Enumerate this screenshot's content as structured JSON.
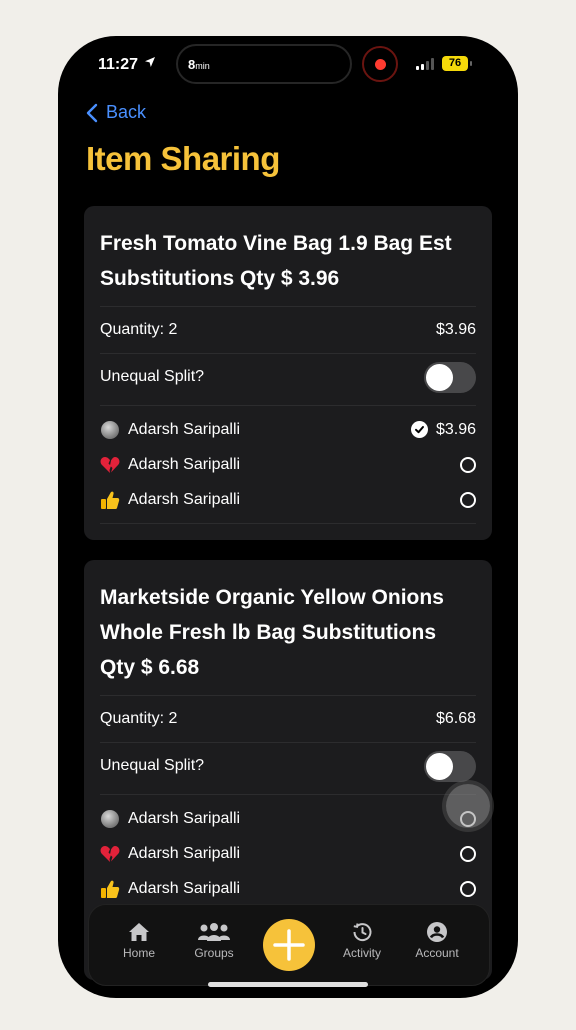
{
  "status": {
    "time": "11:27",
    "timer": "8",
    "timer_unit": "min",
    "battery": "76"
  },
  "nav": {
    "back_label": "Back"
  },
  "page": {
    "title": "Item Sharing"
  },
  "items": [
    {
      "title": "Fresh Tomato Vine Bag 1.9 Bag Est Substitutions Qty $ 3.96",
      "quantity_label": "Quantity: 2",
      "total": "$3.96",
      "unequal_label": "Unequal Split?",
      "unequal_split": false,
      "members": [
        {
          "name": "Adarsh Saripalli",
          "avatar": "moon-emoji",
          "selected": true,
          "amount": "$3.96"
        },
        {
          "name": "Adarsh Saripalli",
          "avatar": "broken-heart-emoji",
          "selected": false,
          "amount": ""
        },
        {
          "name": "Adarsh Saripalli",
          "avatar": "thumbs-up-emoji",
          "selected": false,
          "amount": ""
        }
      ]
    },
    {
      "title": "Marketside Organic Yellow Onions Whole Fresh lb Bag Substitutions Qty $ 6.68",
      "quantity_label": "Quantity: 2",
      "total": "$6.68",
      "unequal_label": "Unequal Split?",
      "unequal_split": false,
      "members": [
        {
          "name": "Adarsh Saripalli",
          "avatar": "moon-emoji",
          "selected": false,
          "amount": ""
        },
        {
          "name": "Adarsh Saripalli",
          "avatar": "broken-heart-emoji",
          "selected": false,
          "amount": ""
        },
        {
          "name": "Adarsh Saripalli",
          "avatar": "thumbs-up-emoji",
          "selected": false,
          "amount": ""
        }
      ]
    }
  ],
  "tabbar": {
    "home": "Home",
    "groups": "Groups",
    "activity": "Activity",
    "account": "Account"
  },
  "colors": {
    "accent": "#f6c23a",
    "link": "#4a90ff",
    "card": "#1c1c1e"
  }
}
